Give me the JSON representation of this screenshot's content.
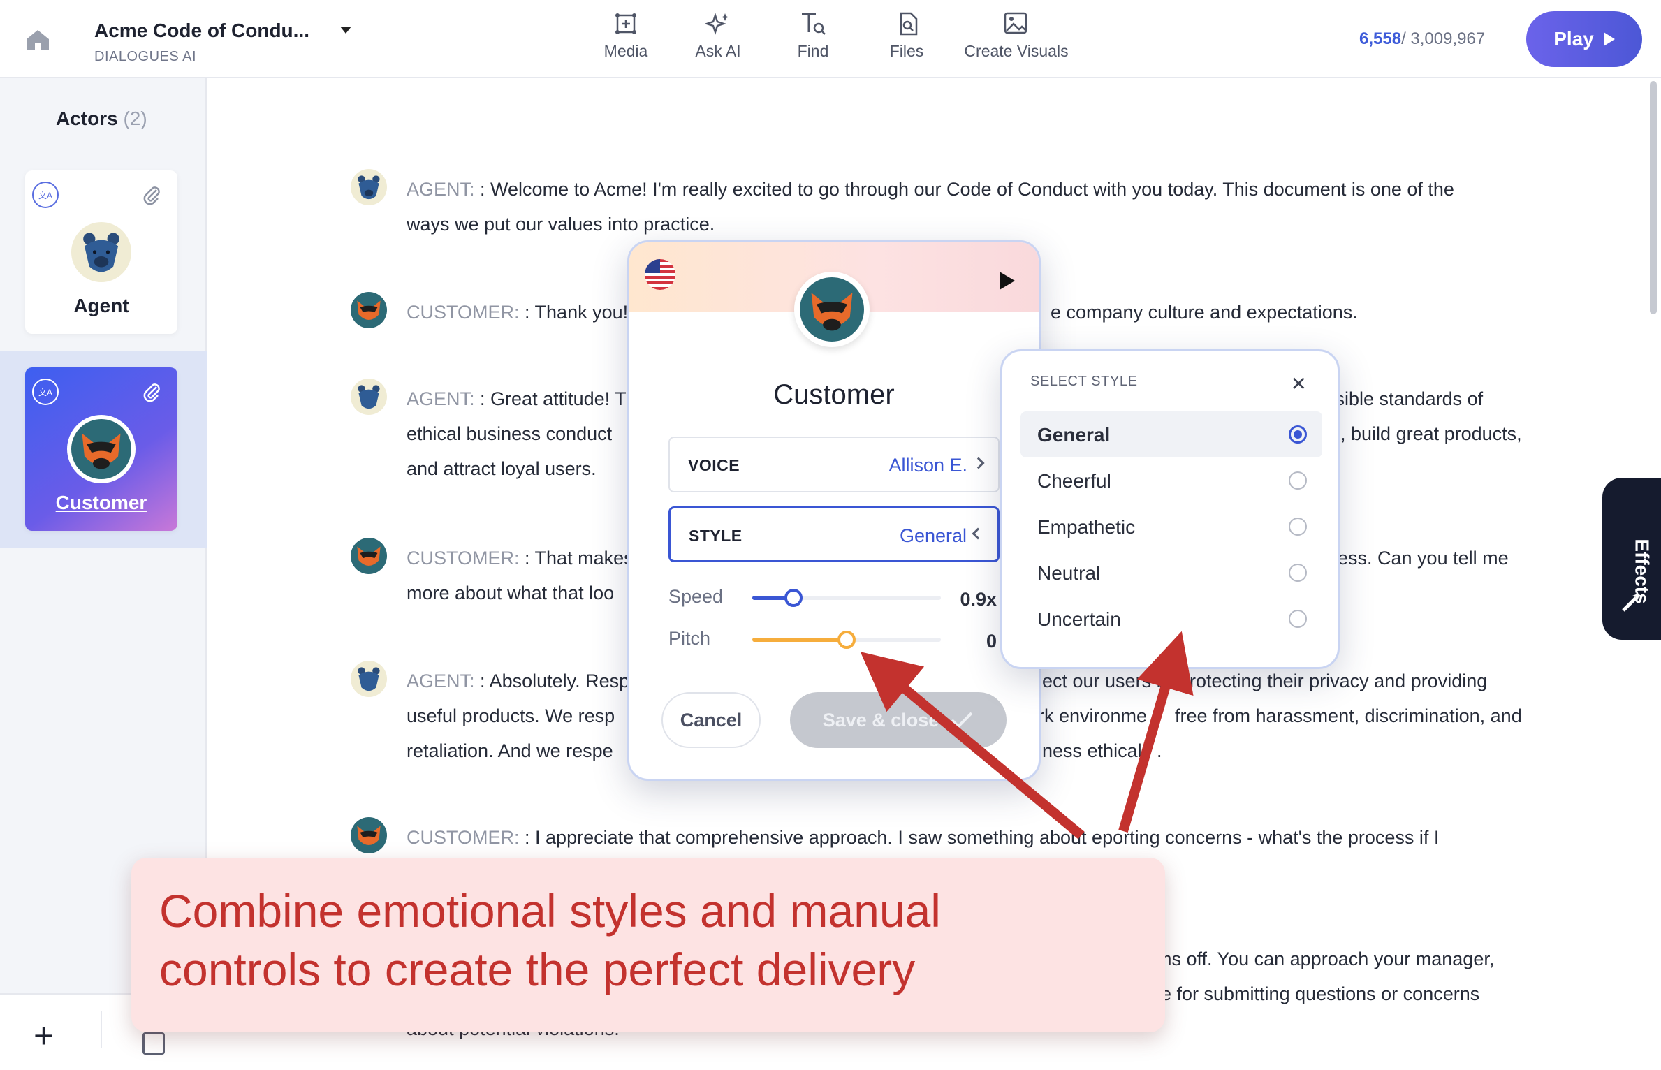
{
  "header": {
    "doc_title": "Acme Code of Condu...",
    "doc_subtitle": "DIALOGUES AI",
    "tools": [
      "Media",
      "Ask AI",
      "Find",
      "Files",
      "Create Visuals"
    ],
    "credits_used": "6,558",
    "credits_total": "/ 3,009,967",
    "play_label": "Play"
  },
  "sidebar": {
    "actors_title": "Actors",
    "actors_count": "(2)",
    "actors": [
      {
        "name": "Agent",
        "icon": "bear-avatar"
      },
      {
        "name": "Customer",
        "icon": "fox-avatar"
      }
    ],
    "add_label": "+"
  },
  "script": [
    {
      "speaker": "AGENT:",
      "avatar": "bear-avatar",
      "lines": [
        ": Welcome to Acme! I'm really excited to go through our Code of Conduct with you today. This document is one of the",
        "ways we put our values into practice."
      ]
    },
    {
      "speaker": "CUSTOMER:",
      "avatar": "fox-avatar",
      "lines": [
        ": Thank you!",
        "e company culture and expectations."
      ]
    },
    {
      "speaker": "AGENT:",
      "avatar": "bear-avatar",
      "lines": [
        ": Great attitude! T",
        "ssible standards of",
        "ethical business conduct",
        "e, build great products,",
        "and attract loyal users."
      ]
    },
    {
      "speaker": "CUSTOMER:",
      "avatar": "fox-avatar",
      "lines": [
        ": That makes",
        "ccess. Can you tell me",
        "more about what that loo"
      ]
    },
    {
      "speaker": "AGENT:",
      "avatar": "bear-avatar",
      "lines": [
        ": Absolutely. Resp",
        "ect our users b",
        "protecting their privacy and providing",
        "useful products. We resp",
        "rk environme",
        "free from harassment, discrimination, and",
        "retaliation. And we respe",
        "ness ethical",
        "."
      ]
    },
    {
      "speaker": "CUSTOMER:",
      "avatar": "fox-avatar",
      "lines": [
        ": I appreciate that comprehensive approach. I saw something a",
        "bout",
        "eporting concerns - what's the process if I"
      ]
    },
    {
      "speaker": "",
      "avatar": "",
      "lines": [
        "ems off. You can approach your manager,",
        "e for submitting questions or concerns",
        "about potential violations."
      ]
    }
  ],
  "effects_label": "Effects",
  "voice_dialog": {
    "actor_name": "Customer",
    "voice_label": "VOICE",
    "voice_value": "Allison E.",
    "style_label": "STYLE",
    "style_value": "General",
    "speed_label": "Speed",
    "speed_value": "0.9x",
    "speed_level": 0.22,
    "pitch_label": "Pitch",
    "pitch_value": "0",
    "pitch_level": 0.5,
    "cancel_label": "Cancel",
    "save_label": "Save & close",
    "accent_blue": "#3a56d4",
    "accent_orange": "#f6ad3c"
  },
  "style_popover": {
    "title": "SELECT STYLE",
    "options": [
      "General",
      "Cheerful",
      "Empathetic",
      "Neutral",
      "Uncertain"
    ],
    "selected": "General"
  },
  "annotation": {
    "text_line1": "Combine emotional styles and manual",
    "text_line2": "controls to create the perfect delivery",
    "color": "#c3322e"
  }
}
